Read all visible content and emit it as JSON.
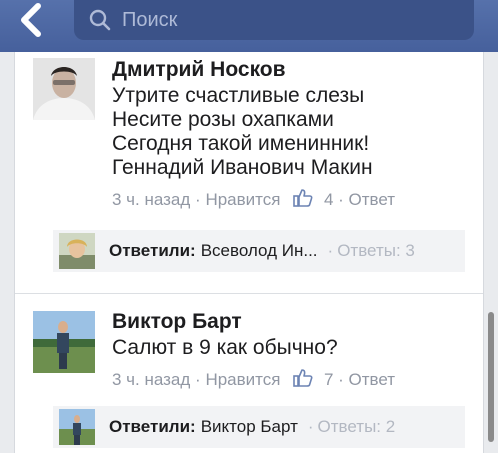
{
  "search": {
    "placeholder": "Поиск"
  },
  "comments": [
    {
      "author": "Дмитрий Носков",
      "lines": [
        "Утрите счастливые слезы",
        "Несите розы охапками",
        "Сегодня такой именинник!",
        "Геннадий Иванович Макин"
      ],
      "time": "3 ч. назад",
      "like_label": "Нравится",
      "like_count": "4",
      "reply_label": "Ответ",
      "replies": {
        "label": "Ответили:",
        "names": "Всеволод Ин...",
        "count": "Ответы: 3"
      }
    },
    {
      "author": "Виктор Барт",
      "lines": [
        "Салют в 9 как обычно?"
      ],
      "time": "3 ч. назад",
      "like_label": "Нравится",
      "like_count": "7",
      "reply_label": "Ответ",
      "replies": {
        "label": "Ответили:",
        "names": "Виктор Барт",
        "count": "Ответы: 2"
      }
    }
  ],
  "separator": "·",
  "colors": {
    "header": "#4a64a0",
    "meta": "#9197a3",
    "reply_bg": "#f2f3f5"
  },
  "icons": [
    "back-chevron-icon",
    "search-icon",
    "like-thumb-icon"
  ]
}
